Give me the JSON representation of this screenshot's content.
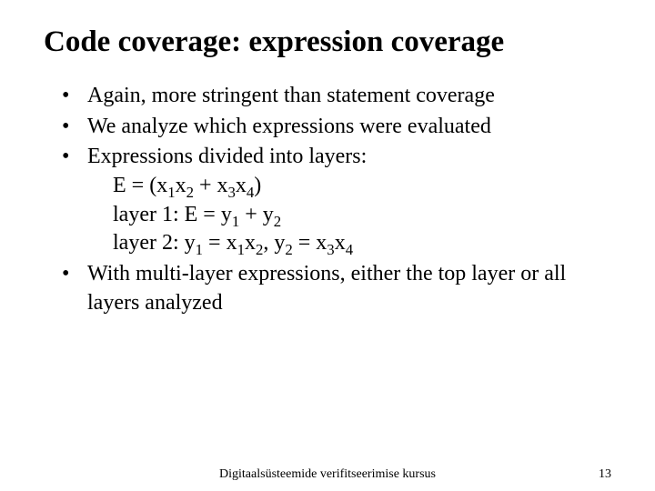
{
  "title": "Code coverage: expression coverage",
  "bullets": {
    "b1": "Again, more stringent than statement coverage",
    "b2": "We analyze which expressions were evaluated",
    "b3": "Expressions divided into layers:",
    "b4": "With multi-layer expressions, either the top layer or all layers analyzed"
  },
  "expr": {
    "line1_prefix": "E = (x",
    "line1_s1": "1",
    "line1_x2": "x",
    "line1_s2": "2",
    "line1_plus": " + x",
    "line1_s3": "3",
    "line1_x4": "x",
    "line1_s4": "4",
    "line1_close": ")",
    "line2_prefix": "layer 1: E = y",
    "line2_s1": "1",
    "line2_plus": " + y",
    "line2_s2": "2",
    "line3_prefix": "layer 2: y",
    "line3_s1": "1",
    "line3_eq1": " = x",
    "line3_s2": "1",
    "line3_x2": "x",
    "line3_s3": "2",
    "line3_comma": ", y",
    "line3_s4": "2",
    "line3_eq2": " = x",
    "line3_s5": "3",
    "line3_x4": "x",
    "line3_s6": "4"
  },
  "footer": {
    "center": "Digitaalsüsteemide verifitseerimise kursus",
    "page": "13"
  }
}
